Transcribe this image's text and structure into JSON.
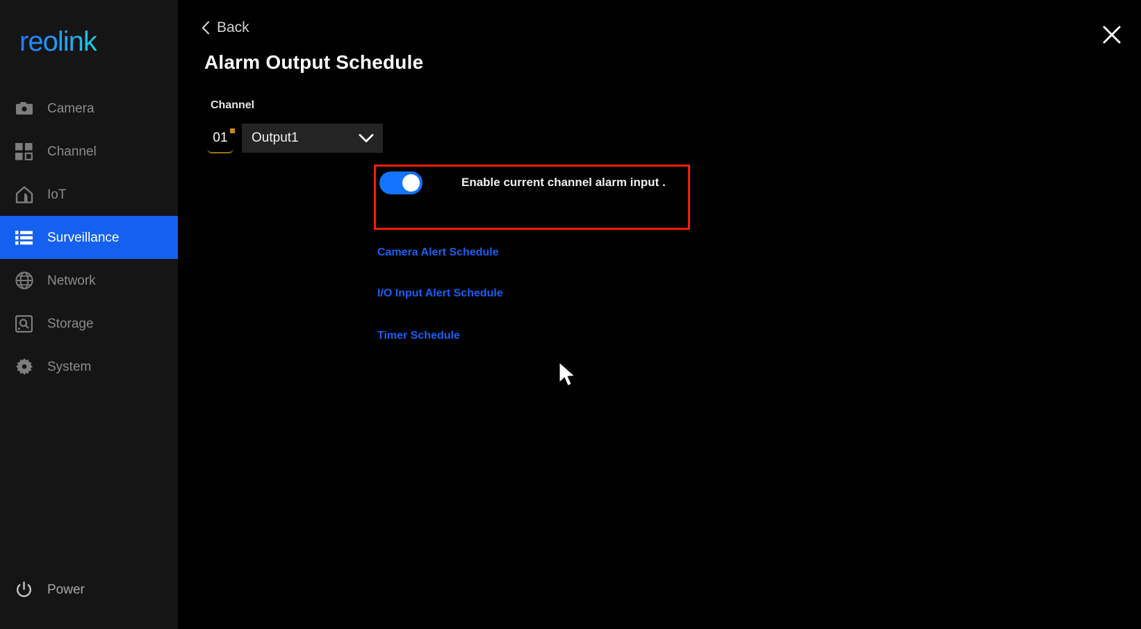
{
  "app": {
    "brand": "reolink",
    "accent_blue": "#1660f0",
    "link_blue": "#1a5ff5",
    "highlight_red": "#fa1d08",
    "sidebar_bg": "#151515",
    "main_bg": "#000000"
  },
  "sidebar": {
    "items": [
      {
        "label": "Camera",
        "icon": "camera-icon",
        "active": false
      },
      {
        "label": "Channel",
        "icon": "grid-icon",
        "active": false
      },
      {
        "label": "IoT",
        "icon": "home-icon",
        "active": false
      },
      {
        "label": "Surveillance",
        "icon": "list-icon",
        "active": true
      },
      {
        "label": "Network",
        "icon": "globe-icon",
        "active": false
      },
      {
        "label": "Storage",
        "icon": "storage-disk-icon",
        "active": false
      },
      {
        "label": "System",
        "icon": "gear-icon",
        "active": false
      }
    ],
    "power": {
      "label": "Power",
      "icon": "power-icon"
    }
  },
  "header": {
    "back_label": "Back",
    "back_icon": "chevron-left-icon",
    "title": "Alarm Output Schedule",
    "close_icon": "close-icon"
  },
  "channel": {
    "label": "Channel",
    "number": "01",
    "select_value": "Output1",
    "select_icon": "chevron-down-icon",
    "options": [
      "Output1"
    ]
  },
  "toggle": {
    "label": "Enable current channel alarm input .",
    "state": "on"
  },
  "links": [
    {
      "label": "Camera Alert Schedule"
    },
    {
      "label": "I/O Input Alert Schedule"
    },
    {
      "label": "Timer Schedule"
    }
  ]
}
